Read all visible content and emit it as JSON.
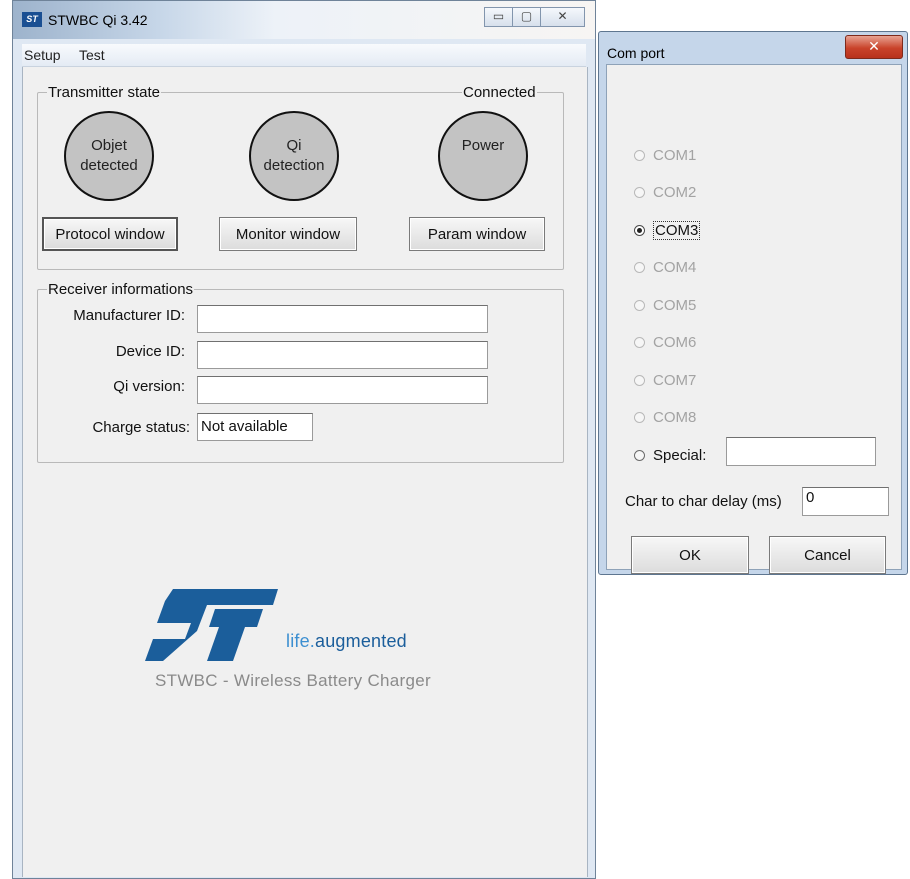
{
  "main_window": {
    "title": "STWBC Qi 3.42",
    "app_icon_text": "ST",
    "controls": {
      "minimize": "▭",
      "maximize": "▢",
      "close": "✕"
    },
    "menu": [
      "Setup",
      "Test"
    ]
  },
  "transmitter": {
    "group_label": "Transmitter state",
    "status": "Connected",
    "leds": [
      {
        "line1": "Objet",
        "line2": "detected"
      },
      {
        "line1": "Qi",
        "line2": "detection"
      },
      {
        "line1": "Power",
        "line2": ""
      }
    ],
    "buttons": {
      "protocol": "Protocol window",
      "monitor": "Monitor window",
      "param": "Param window"
    }
  },
  "receiver": {
    "group_label": "Receiver informations",
    "manufacturer_label": "Manufacturer ID:",
    "manufacturer_value": "",
    "device_label": "Device ID:",
    "device_value": "",
    "qi_version_label": "Qi version:",
    "qi_version_value": "",
    "charge_status_label": "Charge status:",
    "charge_status_value": "Not available"
  },
  "branding": {
    "logo_text": "ST",
    "tagline_life": "life.",
    "tagline_aug": "augmented",
    "product_name": "STWBC - Wireless Battery Charger",
    "logo_color": "#1b5e9b",
    "tagline_color": "#3c8fd1"
  },
  "com_dialog": {
    "title": "Com port",
    "close_glyph": "✕",
    "ports": [
      {
        "label": "COM1",
        "enabled": false,
        "selected": false
      },
      {
        "label": "COM2",
        "enabled": false,
        "selected": false
      },
      {
        "label": "COM3",
        "enabled": true,
        "selected": true
      },
      {
        "label": "COM4",
        "enabled": false,
        "selected": false
      },
      {
        "label": "COM5",
        "enabled": false,
        "selected": false
      },
      {
        "label": "COM6",
        "enabled": false,
        "selected": false
      },
      {
        "label": "COM7",
        "enabled": false,
        "selected": false
      },
      {
        "label": "COM8",
        "enabled": false,
        "selected": false
      }
    ],
    "special_label": "Special:",
    "special_value": "",
    "delay_label": "Char to char delay (ms)",
    "delay_value": "0",
    "ok_label": "OK",
    "cancel_label": "Cancel"
  }
}
